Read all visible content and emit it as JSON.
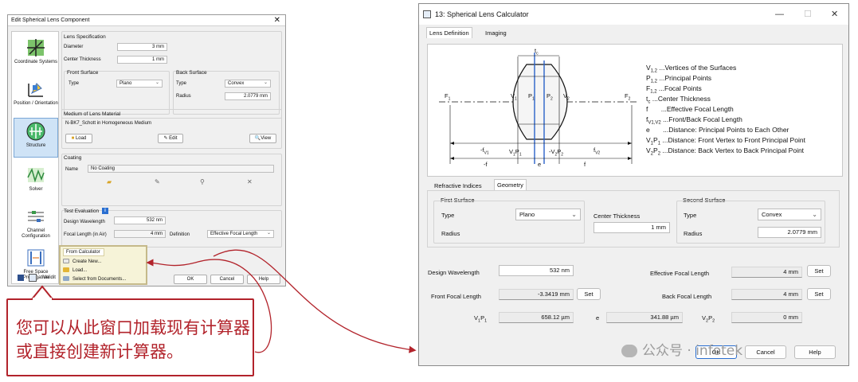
{
  "left_dialog": {
    "title": "Edit Spherical Lens Component",
    "nav": [
      {
        "label": "Coordinate Systems",
        "icon": "coordinate-systems-icon"
      },
      {
        "label": "Position / Orientation",
        "icon": "position-orientation-icon"
      },
      {
        "label": "Structure",
        "icon": "structure-icon"
      },
      {
        "label": "Solver",
        "icon": "solver-icon"
      },
      {
        "label": "Channel Configuration",
        "icon": "channel-configuration-icon"
      },
      {
        "label": "Free Space Propagation",
        "icon": "free-space-propagation-icon"
      }
    ],
    "lens_spec": {
      "title": "Lens Specification",
      "diameter_label": "Diameter",
      "diameter_value": "3 mm",
      "center_thickness_label": "Center Thickness",
      "center_thickness_value": "1 mm",
      "front_title": "Front Surface",
      "front_type_label": "Type",
      "front_type_value": "Plano",
      "back_title": "Back Surface",
      "back_type_label": "Type",
      "back_type_value": "Convex",
      "radius_label": "Radius",
      "radius_value": "2.0779 mm"
    },
    "medium": {
      "title": "Medium of Lens Material",
      "value": "N-BK7_Schott in Homogeneous Medium",
      "load": "Load",
      "edit": "Edit",
      "view": "View"
    },
    "coating": {
      "title": "Coating",
      "name_label": "Name",
      "name_value": "No Coating"
    },
    "test_eval": {
      "title": "Test Evaluation",
      "design_wavelength_label": "Design Wavelength",
      "design_wavelength_value": "532 nm",
      "focal_length_label": "Focal Length (in Air)",
      "focal_length_value": "4 mm",
      "definition_label": "Definition",
      "definition_value": "Effective Focal Length"
    },
    "popup": {
      "header": "From Calculator",
      "items": [
        "Create New...",
        "Load...",
        "Select from Documents..."
      ]
    },
    "footer": {
      "validity": "Validit",
      "ok": "OK",
      "cancel": "Cancel",
      "help": "Help"
    }
  },
  "callout": {
    "text": "您可以从此窗口加载现有计算器或直接创建新计算器。",
    "border_color": "#b2232b"
  },
  "right_dialog": {
    "title": "13: Spherical Lens Calculator",
    "tabs": [
      "Lens Definition",
      "Imaging"
    ],
    "diagram": {
      "F1": "F",
      "F1_sub": "1",
      "F2": "F",
      "F2_sub": "2",
      "V1": "V",
      "V1_sub": "1",
      "V2": "V",
      "V2_sub": "2",
      "P1": "P",
      "P1_sub": "1",
      "P2": "P",
      "P2_sub": "2",
      "tc": "t",
      "tc_sub": "c",
      "ffv1": "-f",
      "ffv1_sub": "V1",
      "v1p1": "V",
      "v1p1_sub": "1",
      "v1p1_b": "P",
      "v1p1_b_sub": "1",
      "v2p2": "-V",
      "v2p2_sub": "2",
      "v2p2_b": "P",
      "v2p2_b_sub": "2",
      "fv2": "f",
      "fv2_sub": "V2",
      "minus_f": "-f",
      "e": "e",
      "f": "f"
    },
    "legend": [
      {
        "sym": "V",
        "sub": "1,2",
        "desc": "...Vertices of the Surfaces"
      },
      {
        "sym": "P",
        "sub": "1,2",
        "desc": "...Principal Points"
      },
      {
        "sym": "F",
        "sub": "1,2",
        "desc": "...Focal Points"
      },
      {
        "sym": "t",
        "sub": "c",
        "desc": "...Center Thickness"
      },
      {
        "sym": "f",
        "sub": "",
        "desc": "...Effective Focal Length"
      },
      {
        "sym": "f",
        "sub": "V1,V2",
        "desc": "...Front/Back Focal Length"
      },
      {
        "sym": "e",
        "sub": "",
        "desc": "...Distance: Principal Points to Each Other"
      },
      {
        "sym": "V",
        "sub": "1",
        "sym2": "P",
        "sub2": "1",
        "desc": "...Distance: Front Vertex to Front Principal Point"
      },
      {
        "sym": "V",
        "sub": "2",
        "sym2": "P",
        "sub2": "2",
        "desc": "...Distance: Back Vertex to Back Principal Point"
      }
    ],
    "subtabs": [
      "Refractive Indices",
      "Geometry"
    ],
    "first_surface": {
      "title": "First Surface",
      "type_label": "Type",
      "type_value": "Plano",
      "radius_label": "Radius"
    },
    "center_thickness_label": "Center Thickness",
    "center_thickness_value": "1 mm",
    "second_surface": {
      "title": "Second Surface",
      "type_label": "Type",
      "type_value": "Convex",
      "radius_label": "Radius",
      "radius_value": "2.0779 mm"
    },
    "design_wavelength_label": "Design Wavelength",
    "design_wavelength_value": "532 nm",
    "effective_focal_label": "Effective Focal Length",
    "effective_focal_value": "4 mm",
    "front_focal_label": "Front Focal Length",
    "front_focal_value": "-3.3419 mm",
    "back_focal_label": "Back Focal Length",
    "back_focal_value": "4 mm",
    "v1p1_label": "V",
    "v1p1_sub": "1",
    "v1p1_label2": "P",
    "v1p1_sub2": "1",
    "v1p1_value": "658.12 µm",
    "e_label": "e",
    "e_value": "341.88 µm",
    "v2p2_label": "V",
    "v2p2_sub": "2",
    "v2p2_label2": "P",
    "v2p2_sub2": "2",
    "v2p2_value": "0 mm",
    "set": "Set",
    "ok": "OK",
    "cancel": "Cancel",
    "help": "Help"
  },
  "watermark": "公众号 · infotek"
}
